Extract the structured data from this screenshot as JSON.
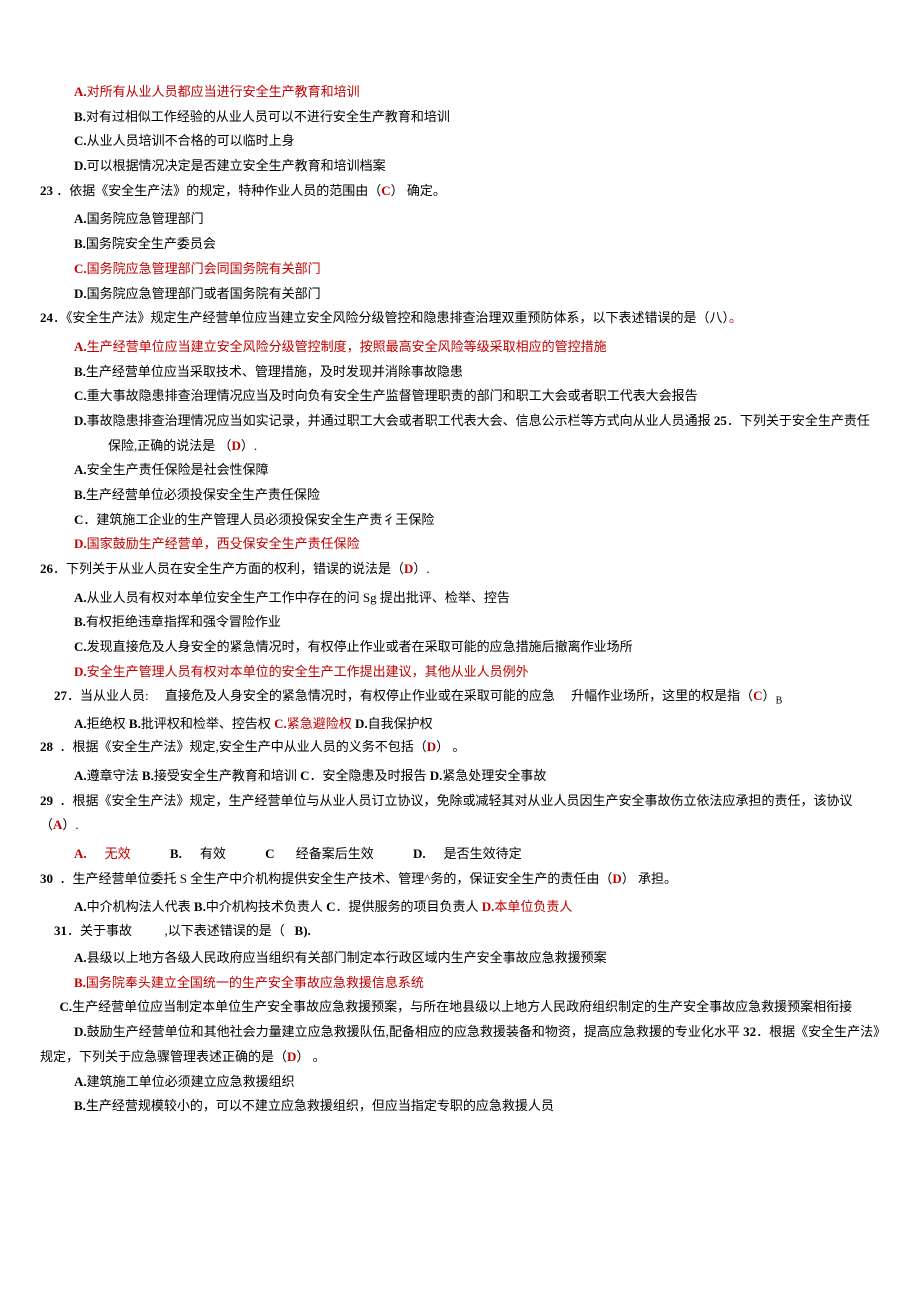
{
  "q22": {
    "A": "对所有从业人员都应当进行安全生产教育和培训",
    "B": "对有过相似工作经验的从业人员可以不进行安全生产教育和培训",
    "C": "从业人员培训不合格的可以临时上身",
    "D": "可以根据情况决定是否建立安全生产教育和培训档案"
  },
  "q23": {
    "num": "23",
    "stem1": "．依据《安全生产法》的规定，特种作业人员的范围由（",
    "ans": "C",
    "stem2": "） 确定。",
    "A": "国务院应急管理部门",
    "B": "国务院安全生产委员会",
    "C": "国务院应急管理部门会同国务院有关部门",
    "D": "国务院应急管理部门或者国务院有关部门"
  },
  "q24": {
    "num": "24",
    "stem": "．《安全生产法》规定生产经营单位应当建立安全风险分级管控和隐患排查治理双重预防体系，以下表述错误的是（八）",
    "dot": "。",
    "A": "生产经营单位应当建立安全风险分级管控制度，按照最高安全风险等级采取相应的管控措施",
    "B": "生产经营单位应当采取技术、管理措施，及时发现并消除事故隐患",
    "C": "重大事故隐患排查治理情况应当及时向负有安全生产监督管理职责的部门和职工大会或者职工代表大会报告",
    "D_pre": "事故隐患排查治理情况应当如实记录，并通过职工大会或者职工代表大会、信息公示栏等方式向从业人员通报 ",
    "q25num": "25",
    "q25stem": "．下列关于安全生产责任保险,正确的说法是 （",
    "q25ans": "D",
    "q25stem2": "）."
  },
  "q25": {
    "A": "安全生产责任保险是社会性保障",
    "B": "生产经营单位必须投保安全生产责任保险",
    "C": "．建筑施工企业的生产管理人员必须投保安全生产责彳王保险",
    "D": "国家鼓励生产经营单，西殳保安全生产责任保险"
  },
  "q26": {
    "num": "26",
    "stem1": "．下列关于从业人员在安全生产方面的权利，错误的说法是（",
    "ans": "D",
    "stem2": "）.",
    "A": "从业人员有权对本单位安全生产工作中存在的问 Sg 提出批评、检举、控告",
    "B": "有权拒绝违章指挥和强令冒险作业",
    "C": "发现直接危及人身安全的紧急情况时，有权停止作业或者在采取可能的应急措施后撤离作业场所",
    "D": "安全生产管理人员有权对本单位的安全生产工作提出建议，其他从业人员例外"
  },
  "q27": {
    "num": "27",
    "stem1": "．当从业人员:",
    "stem2": "直接危及人身安全的紧急情况时，有权停止作业或在采取可能的应急",
    "stem3": "升幅作业场所，这里的权是指（",
    "ans": "C",
    "stem4": "）",
    "sub": "B",
    "A": "拒绝权 ",
    "B": "批评权和检举、控告权 ",
    "C": "紧急避险权 ",
    "D": "自我保护权"
  },
  "q28": {
    "num": "28",
    "stem1": "．根据《安全生产法》规定,安全生产中从业人员的义务不包括（",
    "ans": "D",
    "stem2": "） 。",
    "opts": "遵章守法 B.接受安全生产教育和培训 C.安全隐患及时报告 D.紧急处理安全事故",
    "A": "遵章守法 ",
    "B": "接受安全生产教育和培训 ",
    "Cl": "C",
    "Ctxt": "．安全隐患及时报告 ",
    "D": "紧急处理安全事故"
  },
  "q29": {
    "num": "29",
    "stem1": "．根据《安全生产法》规定，生产经营单位与从业人员订立协议，免除或减轻其对从业人员因生产安全事故伤立依法应承担的责任，该协议（",
    "ans": "A",
    "stem2": "）.",
    "A": "无效",
    "B": "有效",
    "C": "经备案后生效",
    "D": "是否生效待定"
  },
  "q30": {
    "num": "30",
    "stem1": "．生产经营单位委托 S 全生产中介机构提供安全生产技术、管理^务的，保证安全生产的责任由（",
    "ans": "D",
    "stem2": "） 承担。",
    "A": "中介机构法人代表 ",
    "B": "中介机构技术负责人 ",
    "Cl": "C",
    "Ctxt": "．提供服务的项目负责人 ",
    "D": "本单位负责人"
  },
  "q31": {
    "num": "31",
    "stem1": "．关于事故",
    "stem2": ",以下表述错误的是（",
    "ans": "B).",
    "A": "县级以上地方各级人民政府应当组织有关部门制定本行政区域内生产安全事故应急救援预案",
    "B": "国务院奉头建立全国统一的生产安全事故应急救援信息系统",
    "C": "生产经营单位应当制定本单位生产安全事故应急救援预案，与所在地县级以上地方人民政府组织制定的生产安全事故应急救援预案相衔接",
    "D_pre": "鼓励生产经营单位和其他社会力量建立应急救援队伍,配备相应的应急救援装备和物资，提高应急救援的专业化水平 ",
    "q32num": "32",
    "q32stem1": "．根据《安全生产法》规定，下列关于应急骤管理表述正确的是（",
    "q32ans": "D",
    "q32stem2": "） 。"
  },
  "q32": {
    "A": "建筑施工单位必须建立应急救援组织",
    "B": "生产经营规模较小的，可以不建立应急救援组织，但应当指定专职的应急救援人员"
  }
}
